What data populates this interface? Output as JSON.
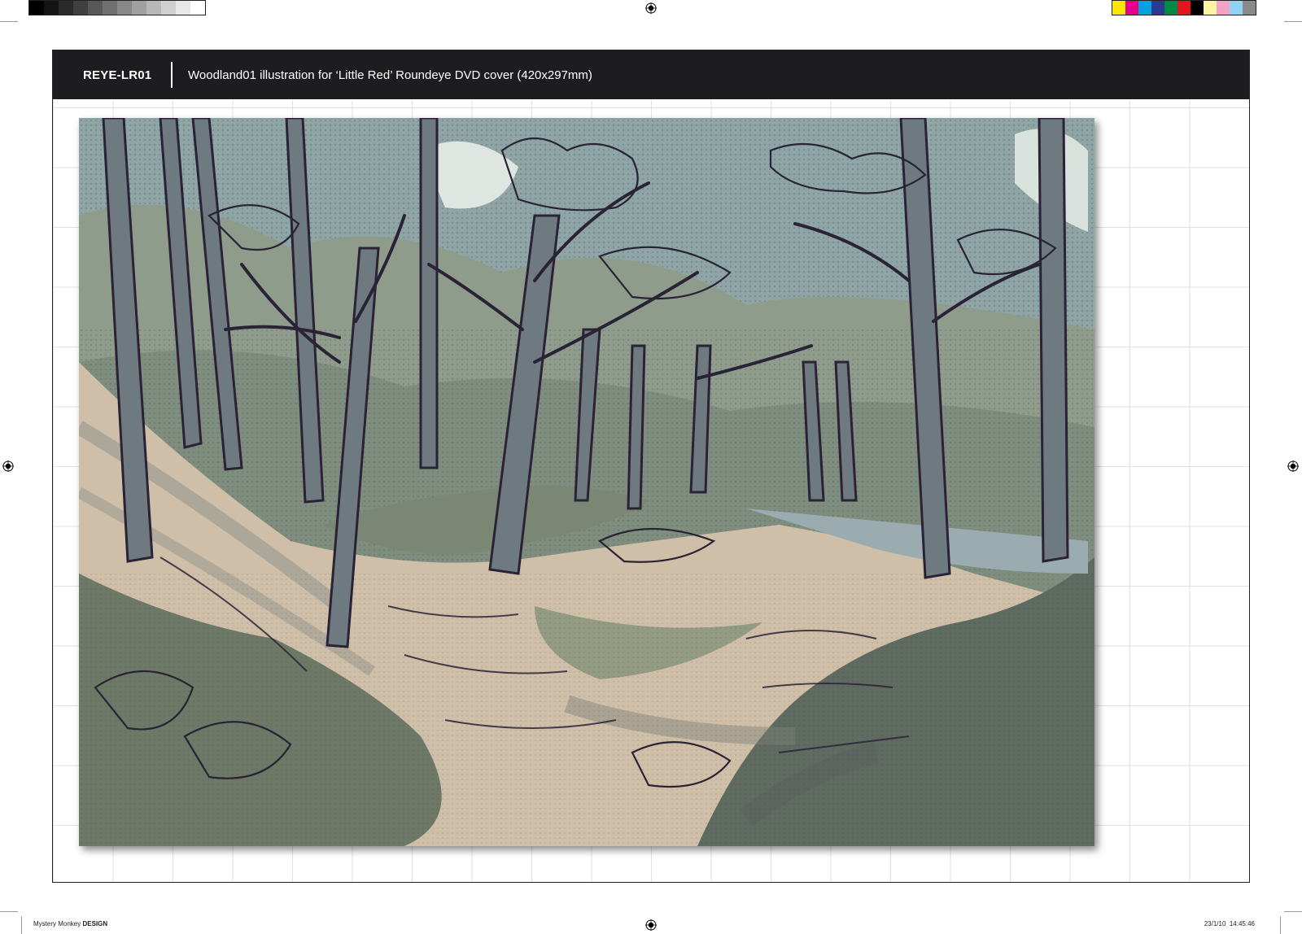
{
  "header": {
    "job_code": "REYE-LR01",
    "description": "Woodland01 illustration for ‘Little Red’ Roundeye DVD cover (420x297mm)"
  },
  "footer": {
    "studio_name": "Mystery Monkey",
    "studio_suffix": "DESIGN",
    "date": "23/1/10",
    "time": "14:45:46"
  },
  "print_marks": {
    "grayscale_swatches": [
      "#000000",
      "#141414",
      "#2a2a2a",
      "#404040",
      "#585858",
      "#707070",
      "#888888",
      "#a0a0a0",
      "#b8b8b8",
      "#d0d0d0",
      "#e8e8e8",
      "#ffffff"
    ],
    "color_swatches": [
      "#fbe600",
      "#e5008a",
      "#00a2e0",
      "#2b3a90",
      "#008a45",
      "#e3161d",
      "#000000",
      "#fdf3a0",
      "#f1a2c6",
      "#8fd3f2",
      "#8a8a8a"
    ],
    "registration_icon": "registration-target-icon"
  },
  "colors": {
    "header_bg": "#1d1d20",
    "header_text": "#ffffff",
    "sheet_border": "#222222",
    "grid_line": "#e2e2e2",
    "art_sky": "#8fa5a5",
    "art_foliage": "#8f9c8c",
    "art_path": "#cfbfa8",
    "art_dark_grass": "#6e7866",
    "art_ink": "#2a2336"
  }
}
